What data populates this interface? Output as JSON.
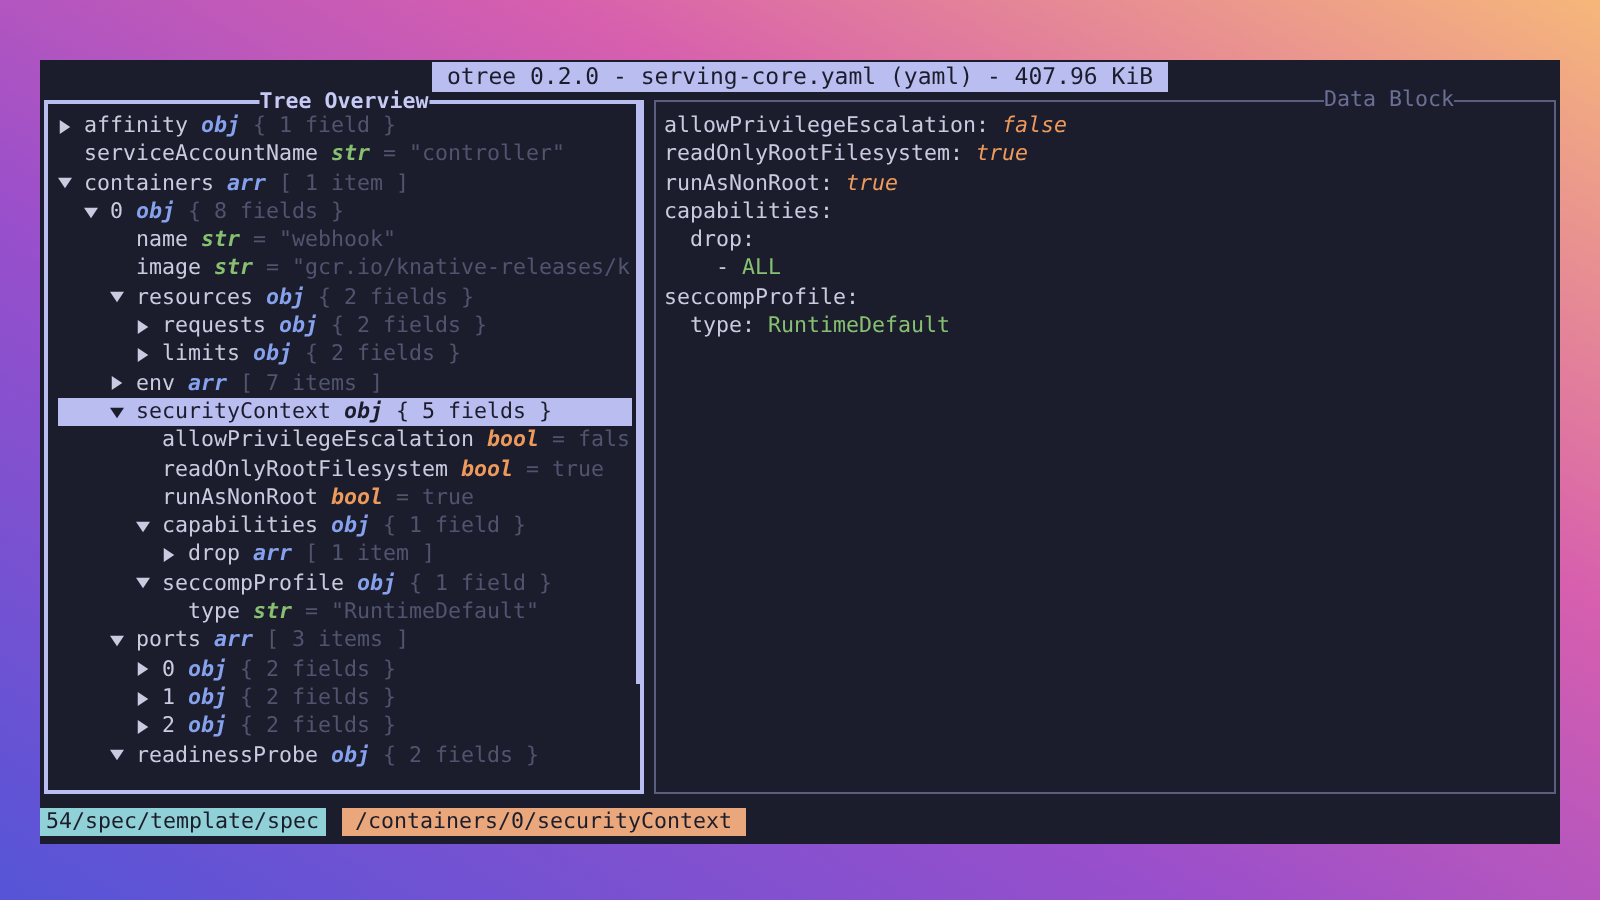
{
  "window": {
    "title": "otree 0.2.0 - serving-core.yaml (yaml) - 407.96 KiB"
  },
  "tree_panel": {
    "title": "Tree Overview",
    "nodes": [
      {
        "key": "affinity",
        "type": "obj",
        "kind": "object",
        "detail": "{ 1 field }",
        "expanded": false,
        "selected": false
      },
      {
        "key": "serviceAccountName",
        "type": "str",
        "kind": "string",
        "detail": "= \"controller\"",
        "selected": false
      },
      {
        "key": "containers",
        "type": "arr",
        "kind": "array",
        "detail": "[ 1 item ]",
        "expanded": true,
        "selected": false,
        "children": [
          {
            "key": "0",
            "type": "obj",
            "kind": "object",
            "detail": "{ 8 fields }",
            "expanded": true,
            "selected": false,
            "children": [
              {
                "key": "name",
                "type": "str",
                "kind": "string",
                "detail": "= \"webhook\"",
                "selected": false
              },
              {
                "key": "image",
                "type": "str",
                "kind": "string",
                "detail": "= \"gcr.io/knative-releases/k",
                "selected": false
              },
              {
                "key": "resources",
                "type": "obj",
                "kind": "object",
                "detail": "{ 2 fields }",
                "expanded": true,
                "selected": false,
                "children": [
                  {
                    "key": "requests",
                    "type": "obj",
                    "kind": "object",
                    "detail": "{ 2 fields }",
                    "expanded": false,
                    "selected": false
                  },
                  {
                    "key": "limits",
                    "type": "obj",
                    "kind": "object",
                    "detail": "{ 2 fields }",
                    "expanded": false,
                    "selected": false
                  }
                ]
              },
              {
                "key": "env",
                "type": "arr",
                "kind": "array",
                "detail": "[ 7 items ]",
                "expanded": false,
                "selected": false
              },
              {
                "key": "securityContext",
                "type": "obj",
                "kind": "object",
                "detail": "{ 5 fields }",
                "expanded": true,
                "selected": true,
                "children": [
                  {
                    "key": "allowPrivilegeEscalation",
                    "type": "bool",
                    "kind": "boolean",
                    "detail": "= fals",
                    "selected": false
                  },
                  {
                    "key": "readOnlyRootFilesystem",
                    "type": "bool",
                    "kind": "boolean",
                    "detail": "= true",
                    "selected": false
                  },
                  {
                    "key": "runAsNonRoot",
                    "type": "bool",
                    "kind": "boolean",
                    "detail": "= true",
                    "selected": false
                  },
                  {
                    "key": "capabilities",
                    "type": "obj",
                    "kind": "object",
                    "detail": "{ 1 field }",
                    "expanded": true,
                    "selected": false,
                    "children": [
                      {
                        "key": "drop",
                        "type": "arr",
                        "kind": "array",
                        "detail": "[ 1 item ]",
                        "expanded": false,
                        "selected": false
                      }
                    ]
                  },
                  {
                    "key": "seccompProfile",
                    "type": "obj",
                    "kind": "object",
                    "detail": "{ 1 field }",
                    "expanded": true,
                    "selected": false,
                    "children": [
                      {
                        "key": "type",
                        "type": "str",
                        "kind": "string",
                        "detail": "= \"RuntimeDefault\"",
                        "selected": false
                      }
                    ]
                  }
                ]
              },
              {
                "key": "ports",
                "type": "arr",
                "kind": "array",
                "detail": "[ 3 items ]",
                "expanded": true,
                "selected": false,
                "children": [
                  {
                    "key": "0",
                    "type": "obj",
                    "kind": "object",
                    "detail": "{ 2 fields }",
                    "expanded": false,
                    "selected": false
                  },
                  {
                    "key": "1",
                    "type": "obj",
                    "kind": "object",
                    "detail": "{ 2 fields }",
                    "expanded": false,
                    "selected": false
                  },
                  {
                    "key": "2",
                    "type": "obj",
                    "kind": "object",
                    "detail": "{ 2 fields }",
                    "expanded": false,
                    "selected": false
                  }
                ]
              },
              {
                "key": "readinessProbe",
                "type": "obj",
                "kind": "object",
                "detail": "{ 2 fields }",
                "expanded": true,
                "selected": false
              }
            ]
          }
        ]
      }
    ]
  },
  "data_block": {
    "title": "Data Block",
    "lines": [
      {
        "key": "allowPrivilegeEscalation:",
        "value": "false",
        "kind": "boolean"
      },
      {
        "key": "readOnlyRootFilesystem:",
        "value": "true",
        "kind": "boolean"
      },
      {
        "key": "runAsNonRoot:",
        "value": "true",
        "kind": "boolean"
      },
      {
        "key": "capabilities:",
        "children": [
          {
            "key": "drop:",
            "children": [
              {
                "key": "-",
                "value": "ALL",
                "kind": "string"
              }
            ]
          }
        ]
      },
      {
        "key": "seccompProfile:",
        "children": [
          {
            "key": "type:",
            "value": "RuntimeDefault",
            "kind": "string"
          }
        ]
      }
    ]
  },
  "status_bar": {
    "path": "54/spec/template/spec",
    "selection": "/containers/0/securityContext"
  }
}
